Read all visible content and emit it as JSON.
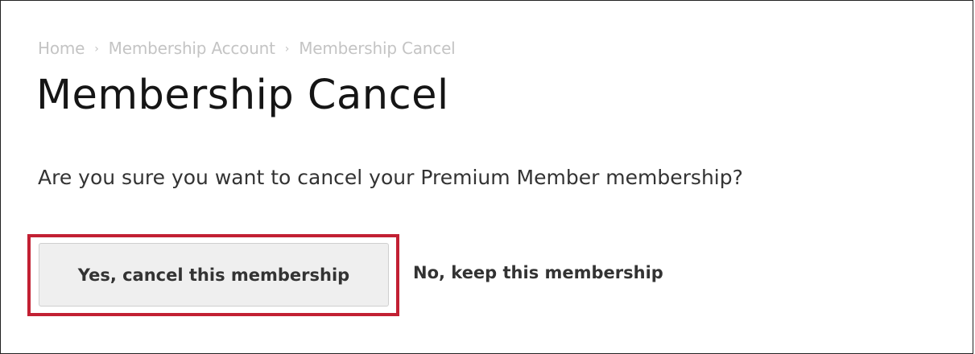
{
  "breadcrumb": {
    "items": [
      "Home",
      "Membership Account",
      "Membership Cancel"
    ],
    "separator": "›"
  },
  "page": {
    "title": "Membership Cancel",
    "question": "Are you sure you want to cancel your Premium Member membership?"
  },
  "actions": {
    "confirm_label": "Yes, cancel this membership",
    "keep_label": "No, keep this membership"
  },
  "colors": {
    "highlight": "#c22033",
    "breadcrumb_text": "#c4c4c4",
    "button_bg": "#efefef"
  }
}
